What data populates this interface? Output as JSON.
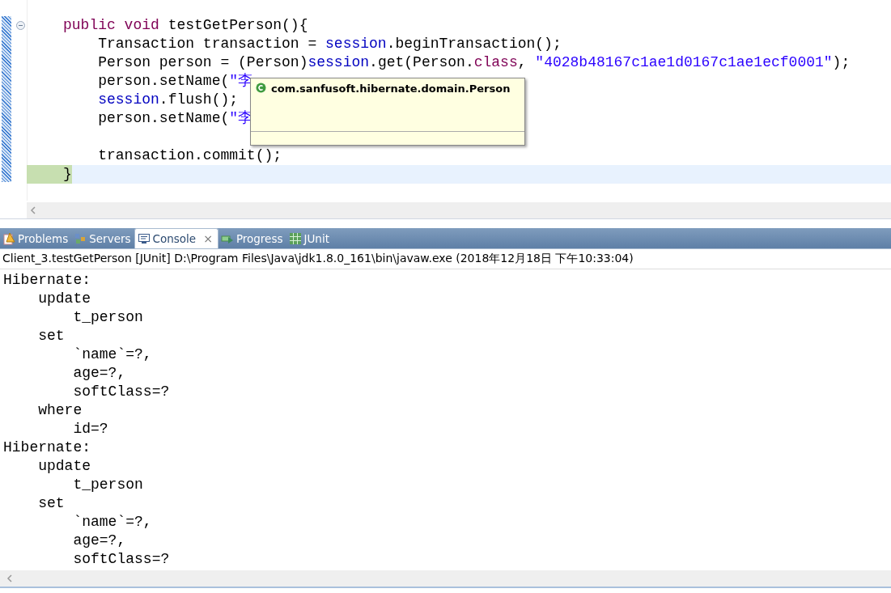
{
  "editor": {
    "lines": [
      {
        "current": false,
        "segments": [
          {
            "kind": "keyword",
            "text": "public void"
          },
          {
            "kind": "plain",
            "text": " testGetPerson(){"
          }
        ]
      },
      {
        "current": false,
        "segments": [
          {
            "kind": "plain",
            "text": "    Transaction transaction = "
          },
          {
            "kind": "field",
            "text": "session"
          },
          {
            "kind": "plain",
            "text": ".beginTransaction();"
          }
        ]
      },
      {
        "current": false,
        "segments": [
          {
            "kind": "plain",
            "text": "    Person person = (Person)"
          },
          {
            "kind": "field",
            "text": "session"
          },
          {
            "kind": "plain",
            "text": ".get(Person."
          },
          {
            "kind": "keyword",
            "text": "class"
          },
          {
            "kind": "plain",
            "text": ", "
          },
          {
            "kind": "string",
            "text": "\"4028b48167c1ae1d0167c1ae1ecf0001\""
          },
          {
            "kind": "plain",
            "text": ");"
          }
        ]
      },
      {
        "current": false,
        "segments": [
          {
            "kind": "plain",
            "text": "    person.setName("
          },
          {
            "kind": "string",
            "text": "\"李"
          }
        ]
      },
      {
        "current": false,
        "segments": [
          {
            "kind": "field",
            "text": "    session"
          },
          {
            "kind": "plain",
            "text": ".flush();"
          }
        ]
      },
      {
        "current": false,
        "segments": [
          {
            "kind": "plain",
            "text": "    person.setName("
          },
          {
            "kind": "string",
            "text": "\"李"
          }
        ]
      },
      {
        "current": false
      },
      {
        "current": false,
        "segments": [
          {
            "kind": "plain",
            "text": "    transaction.commit();"
          }
        ]
      },
      {
        "current": true,
        "segments": [
          {
            "kind": "plain",
            "text": "}"
          }
        ]
      }
    ],
    "tooltip": {
      "text": "com.sanfusoft.hibernate.domain.Person"
    }
  },
  "tabs": [
    {
      "label": "Problems",
      "selected": false
    },
    {
      "label": "Servers",
      "selected": false
    },
    {
      "label": "Console",
      "selected": true,
      "close": "×"
    },
    {
      "label": "Progress",
      "selected": false
    },
    {
      "label": "JUnit",
      "selected": false
    }
  ],
  "console": {
    "header": "Client_3.testGetPerson [JUnit] D:\\Program Files\\Java\\jdk1.8.0_161\\bin\\javaw.exe (2018年12月18日 下午10:33:04)",
    "lines": [
      "Hibernate:",
      "    update",
      "        t_person",
      "    set",
      "        `name`=?,",
      "        age=?,",
      "        softClass=?",
      "    where",
      "        id=?",
      "Hibernate:",
      "    update",
      "        t_person",
      "    set",
      "        `name`=?,",
      "        age=?,",
      "        softClass=?"
    ]
  }
}
